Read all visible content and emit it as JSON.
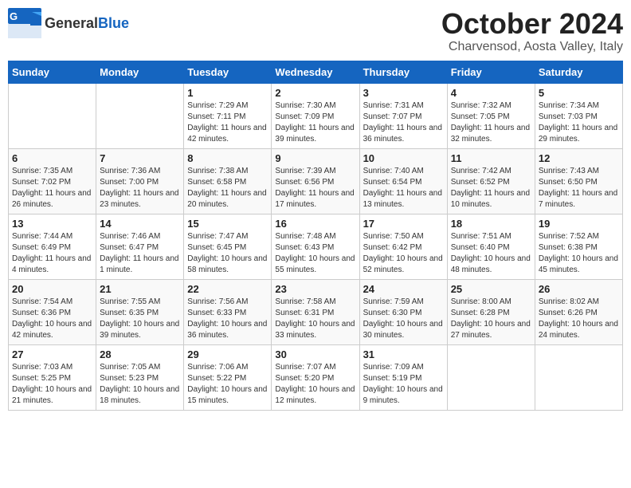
{
  "header": {
    "logo": {
      "general": "General",
      "blue": "Blue"
    },
    "title": "October 2024",
    "location": "Charvensod, Aosta Valley, Italy"
  },
  "days_of_week": [
    "Sunday",
    "Monday",
    "Tuesday",
    "Wednesday",
    "Thursday",
    "Friday",
    "Saturday"
  ],
  "weeks": [
    [
      {
        "day": "",
        "info": ""
      },
      {
        "day": "",
        "info": ""
      },
      {
        "day": "1",
        "sunrise": "Sunrise: 7:29 AM",
        "sunset": "Sunset: 7:11 PM",
        "daylight": "Daylight: 11 hours and 42 minutes."
      },
      {
        "day": "2",
        "sunrise": "Sunrise: 7:30 AM",
        "sunset": "Sunset: 7:09 PM",
        "daylight": "Daylight: 11 hours and 39 minutes."
      },
      {
        "day": "3",
        "sunrise": "Sunrise: 7:31 AM",
        "sunset": "Sunset: 7:07 PM",
        "daylight": "Daylight: 11 hours and 36 minutes."
      },
      {
        "day": "4",
        "sunrise": "Sunrise: 7:32 AM",
        "sunset": "Sunset: 7:05 PM",
        "daylight": "Daylight: 11 hours and 32 minutes."
      },
      {
        "day": "5",
        "sunrise": "Sunrise: 7:34 AM",
        "sunset": "Sunset: 7:03 PM",
        "daylight": "Daylight: 11 hours and 29 minutes."
      }
    ],
    [
      {
        "day": "6",
        "sunrise": "Sunrise: 7:35 AM",
        "sunset": "Sunset: 7:02 PM",
        "daylight": "Daylight: 11 hours and 26 minutes."
      },
      {
        "day": "7",
        "sunrise": "Sunrise: 7:36 AM",
        "sunset": "Sunset: 7:00 PM",
        "daylight": "Daylight: 11 hours and 23 minutes."
      },
      {
        "day": "8",
        "sunrise": "Sunrise: 7:38 AM",
        "sunset": "Sunset: 6:58 PM",
        "daylight": "Daylight: 11 hours and 20 minutes."
      },
      {
        "day": "9",
        "sunrise": "Sunrise: 7:39 AM",
        "sunset": "Sunset: 6:56 PM",
        "daylight": "Daylight: 11 hours and 17 minutes."
      },
      {
        "day": "10",
        "sunrise": "Sunrise: 7:40 AM",
        "sunset": "Sunset: 6:54 PM",
        "daylight": "Daylight: 11 hours and 13 minutes."
      },
      {
        "day": "11",
        "sunrise": "Sunrise: 7:42 AM",
        "sunset": "Sunset: 6:52 PM",
        "daylight": "Daylight: 11 hours and 10 minutes."
      },
      {
        "day": "12",
        "sunrise": "Sunrise: 7:43 AM",
        "sunset": "Sunset: 6:50 PM",
        "daylight": "Daylight: 11 hours and 7 minutes."
      }
    ],
    [
      {
        "day": "13",
        "sunrise": "Sunrise: 7:44 AM",
        "sunset": "Sunset: 6:49 PM",
        "daylight": "Daylight: 11 hours and 4 minutes."
      },
      {
        "day": "14",
        "sunrise": "Sunrise: 7:46 AM",
        "sunset": "Sunset: 6:47 PM",
        "daylight": "Daylight: 11 hours and 1 minute."
      },
      {
        "day": "15",
        "sunrise": "Sunrise: 7:47 AM",
        "sunset": "Sunset: 6:45 PM",
        "daylight": "Daylight: 10 hours and 58 minutes."
      },
      {
        "day": "16",
        "sunrise": "Sunrise: 7:48 AM",
        "sunset": "Sunset: 6:43 PM",
        "daylight": "Daylight: 10 hours and 55 minutes."
      },
      {
        "day": "17",
        "sunrise": "Sunrise: 7:50 AM",
        "sunset": "Sunset: 6:42 PM",
        "daylight": "Daylight: 10 hours and 52 minutes."
      },
      {
        "day": "18",
        "sunrise": "Sunrise: 7:51 AM",
        "sunset": "Sunset: 6:40 PM",
        "daylight": "Daylight: 10 hours and 48 minutes."
      },
      {
        "day": "19",
        "sunrise": "Sunrise: 7:52 AM",
        "sunset": "Sunset: 6:38 PM",
        "daylight": "Daylight: 10 hours and 45 minutes."
      }
    ],
    [
      {
        "day": "20",
        "sunrise": "Sunrise: 7:54 AM",
        "sunset": "Sunset: 6:36 PM",
        "daylight": "Daylight: 10 hours and 42 minutes."
      },
      {
        "day": "21",
        "sunrise": "Sunrise: 7:55 AM",
        "sunset": "Sunset: 6:35 PM",
        "daylight": "Daylight: 10 hours and 39 minutes."
      },
      {
        "day": "22",
        "sunrise": "Sunrise: 7:56 AM",
        "sunset": "Sunset: 6:33 PM",
        "daylight": "Daylight: 10 hours and 36 minutes."
      },
      {
        "day": "23",
        "sunrise": "Sunrise: 7:58 AM",
        "sunset": "Sunset: 6:31 PM",
        "daylight": "Daylight: 10 hours and 33 minutes."
      },
      {
        "day": "24",
        "sunrise": "Sunrise: 7:59 AM",
        "sunset": "Sunset: 6:30 PM",
        "daylight": "Daylight: 10 hours and 30 minutes."
      },
      {
        "day": "25",
        "sunrise": "Sunrise: 8:00 AM",
        "sunset": "Sunset: 6:28 PM",
        "daylight": "Daylight: 10 hours and 27 minutes."
      },
      {
        "day": "26",
        "sunrise": "Sunrise: 8:02 AM",
        "sunset": "Sunset: 6:26 PM",
        "daylight": "Daylight: 10 hours and 24 minutes."
      }
    ],
    [
      {
        "day": "27",
        "sunrise": "Sunrise: 7:03 AM",
        "sunset": "Sunset: 5:25 PM",
        "daylight": "Daylight: 10 hours and 21 minutes."
      },
      {
        "day": "28",
        "sunrise": "Sunrise: 7:05 AM",
        "sunset": "Sunset: 5:23 PM",
        "daylight": "Daylight: 10 hours and 18 minutes."
      },
      {
        "day": "29",
        "sunrise": "Sunrise: 7:06 AM",
        "sunset": "Sunset: 5:22 PM",
        "daylight": "Daylight: 10 hours and 15 minutes."
      },
      {
        "day": "30",
        "sunrise": "Sunrise: 7:07 AM",
        "sunset": "Sunset: 5:20 PM",
        "daylight": "Daylight: 10 hours and 12 minutes."
      },
      {
        "day": "31",
        "sunrise": "Sunrise: 7:09 AM",
        "sunset": "Sunset: 5:19 PM",
        "daylight": "Daylight: 10 hours and 9 minutes."
      },
      {
        "day": "",
        "info": ""
      },
      {
        "day": "",
        "info": ""
      }
    ]
  ]
}
